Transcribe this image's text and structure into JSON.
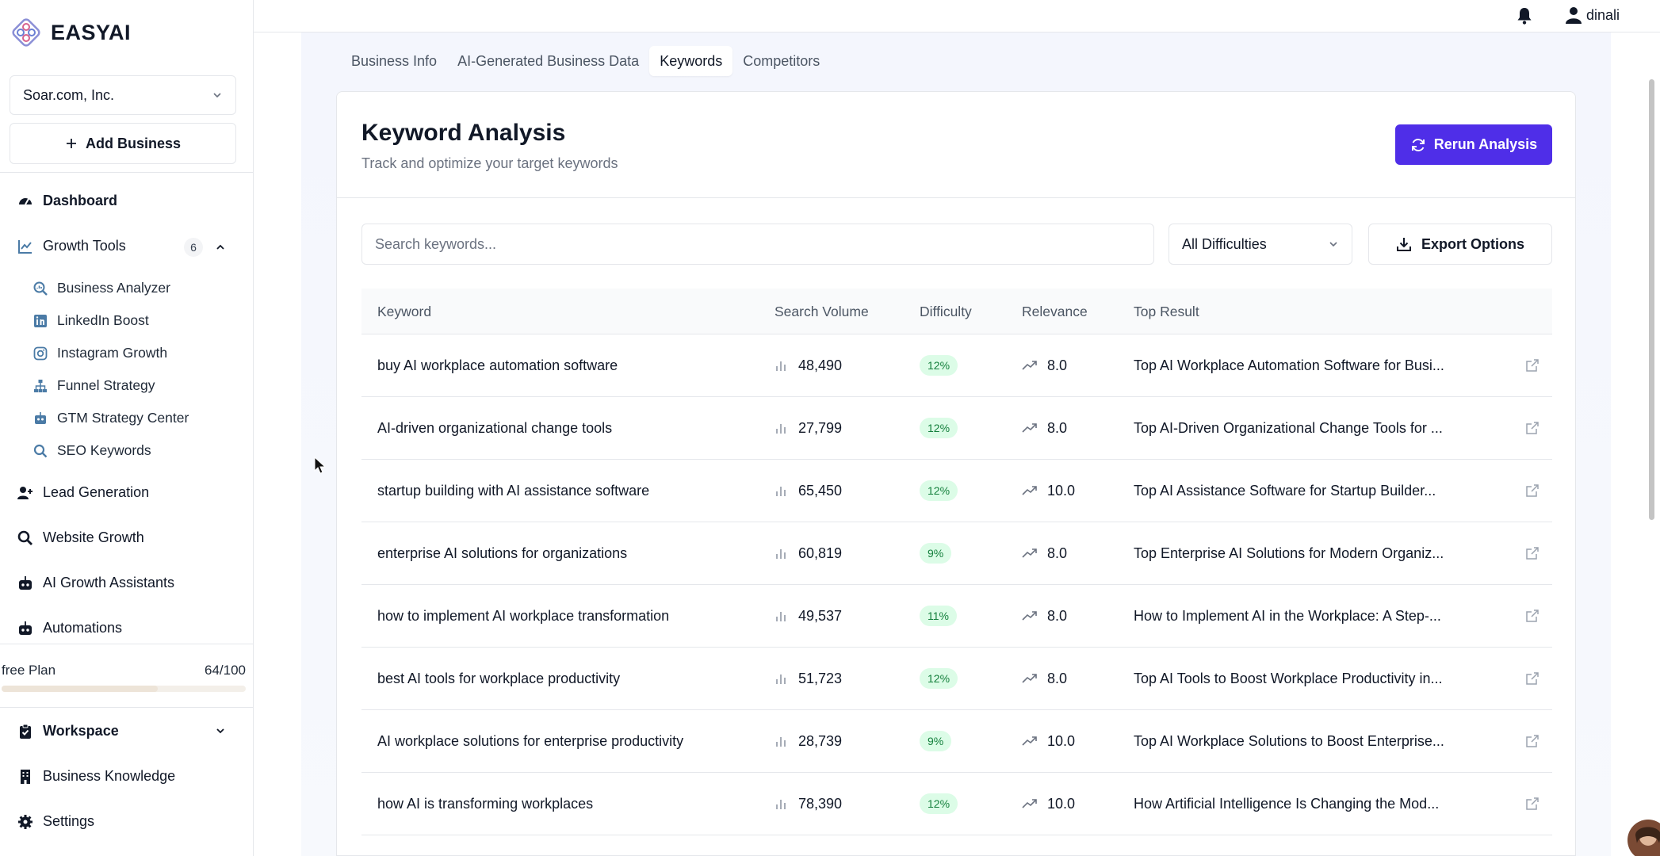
{
  "app": {
    "name": "EASYAI"
  },
  "sidebar": {
    "business_selected": "Soar.com, Inc.",
    "add_business_label": "Add Business",
    "dashboard": "Dashboard",
    "growth_tools": {
      "label": "Growth Tools",
      "count": "6"
    },
    "sub_items": [
      {
        "label": "Business Analyzer",
        "icon": "search-chart-icon"
      },
      {
        "label": "LinkedIn Boost",
        "icon": "linkedin-icon"
      },
      {
        "label": "Instagram Growth",
        "icon": "instagram-icon"
      },
      {
        "label": "Funnel Strategy",
        "icon": "sitemap-icon"
      },
      {
        "label": "GTM Strategy Center",
        "icon": "robot-icon"
      },
      {
        "label": "SEO Keywords",
        "icon": "search-icon"
      }
    ],
    "lead_generation": "Lead Generation",
    "website_growth": "Website Growth",
    "ai_growth_assistants": "AI Growth Assistants",
    "automations": "Automations",
    "plan": {
      "name": "free Plan",
      "usage": "64/100",
      "fraction": 0.64
    },
    "workspace": "Workspace",
    "business_knowledge": "Business Knowledge",
    "settings": "Settings"
  },
  "topbar": {
    "username": "dinali"
  },
  "tabs": [
    {
      "label": "Business Info",
      "active": false
    },
    {
      "label": "AI-Generated Business Data",
      "active": false
    },
    {
      "label": "Keywords",
      "active": true
    },
    {
      "label": "Competitors",
      "active": false
    }
  ],
  "card": {
    "title": "Keyword Analysis",
    "subtitle": "Track and optimize your target keywords",
    "rerun_label": "Rerun Analysis",
    "search_placeholder": "Search keywords...",
    "difficulty_filter": "All Difficulties",
    "export_label": "Export Options"
  },
  "table": {
    "headers": {
      "keyword": "Keyword",
      "volume": "Search Volume",
      "difficulty": "Difficulty",
      "relevance": "Relevance",
      "top": "Top Result"
    },
    "rows": [
      {
        "keyword": "buy AI workplace automation software",
        "volume": "48,490",
        "difficulty": "12%",
        "relevance": "8.0",
        "top": "Top AI Workplace Automation Software for Busi..."
      },
      {
        "keyword": "AI-driven organizational change tools",
        "volume": "27,799",
        "difficulty": "12%",
        "relevance": "8.0",
        "top": "Top AI-Driven Organizational Change Tools for ..."
      },
      {
        "keyword": "startup building with AI assistance software",
        "volume": "65,450",
        "difficulty": "12%",
        "relevance": "10.0",
        "top": "Top AI Assistance Software for Startup Builder..."
      },
      {
        "keyword": "enterprise AI solutions for organizations",
        "volume": "60,819",
        "difficulty": "9%",
        "relevance": "8.0",
        "top": "Top Enterprise AI Solutions for Modern Organiz..."
      },
      {
        "keyword": "how to implement AI workplace transformation",
        "volume": "49,537",
        "difficulty": "11%",
        "relevance": "8.0",
        "top": "How to Implement AI in the Workplace: A Step-..."
      },
      {
        "keyword": "best AI tools for workplace productivity",
        "volume": "51,723",
        "difficulty": "12%",
        "relevance": "8.0",
        "top": "Top AI Tools to Boost Workplace Productivity in..."
      },
      {
        "keyword": "AI workplace solutions for enterprise productivity",
        "volume": "28,739",
        "difficulty": "9%",
        "relevance": "10.0",
        "top": "Top AI Workplace Solutions to Boost Enterprise..."
      },
      {
        "keyword": "how AI is transforming workplaces",
        "volume": "78,390",
        "difficulty": "12%",
        "relevance": "10.0",
        "top": "How Artificial Intelligence Is Changing the Mod..."
      }
    ]
  },
  "colors": {
    "accent": "#4f2ee8",
    "pill_bg": "#dcfce7",
    "pill_text": "#15803d",
    "icon_blue": "#4b7ba6"
  }
}
